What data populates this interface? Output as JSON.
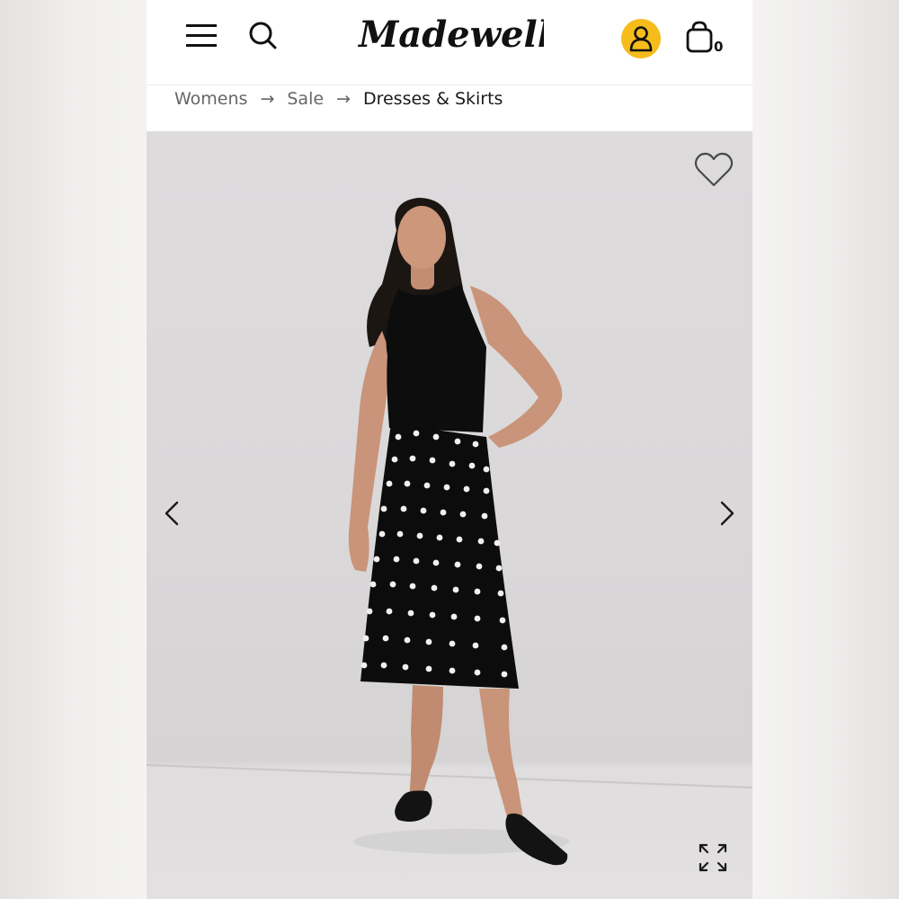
{
  "header": {
    "logo_text": "Madewell",
    "icons": {
      "menu": "hamburger-menu-icon",
      "search": "search-icon",
      "account": "account-icon",
      "bag": "shopping-bag-icon"
    },
    "account_badge_color": "#f5bc1c",
    "bag_count": "0"
  },
  "breadcrumb": {
    "items": [
      {
        "label": "Womens"
      },
      {
        "label": "Sale"
      },
      {
        "label": "Dresses & Skirts"
      }
    ],
    "separator": "→"
  },
  "gallery": {
    "image_description": "model-wearing-black-polka-dot-midi-skirt",
    "icons": {
      "favorite": "heart-outline-icon",
      "prev": "chevron-left-icon",
      "next": "chevron-right-icon",
      "expand": "expand-icon"
    }
  }
}
